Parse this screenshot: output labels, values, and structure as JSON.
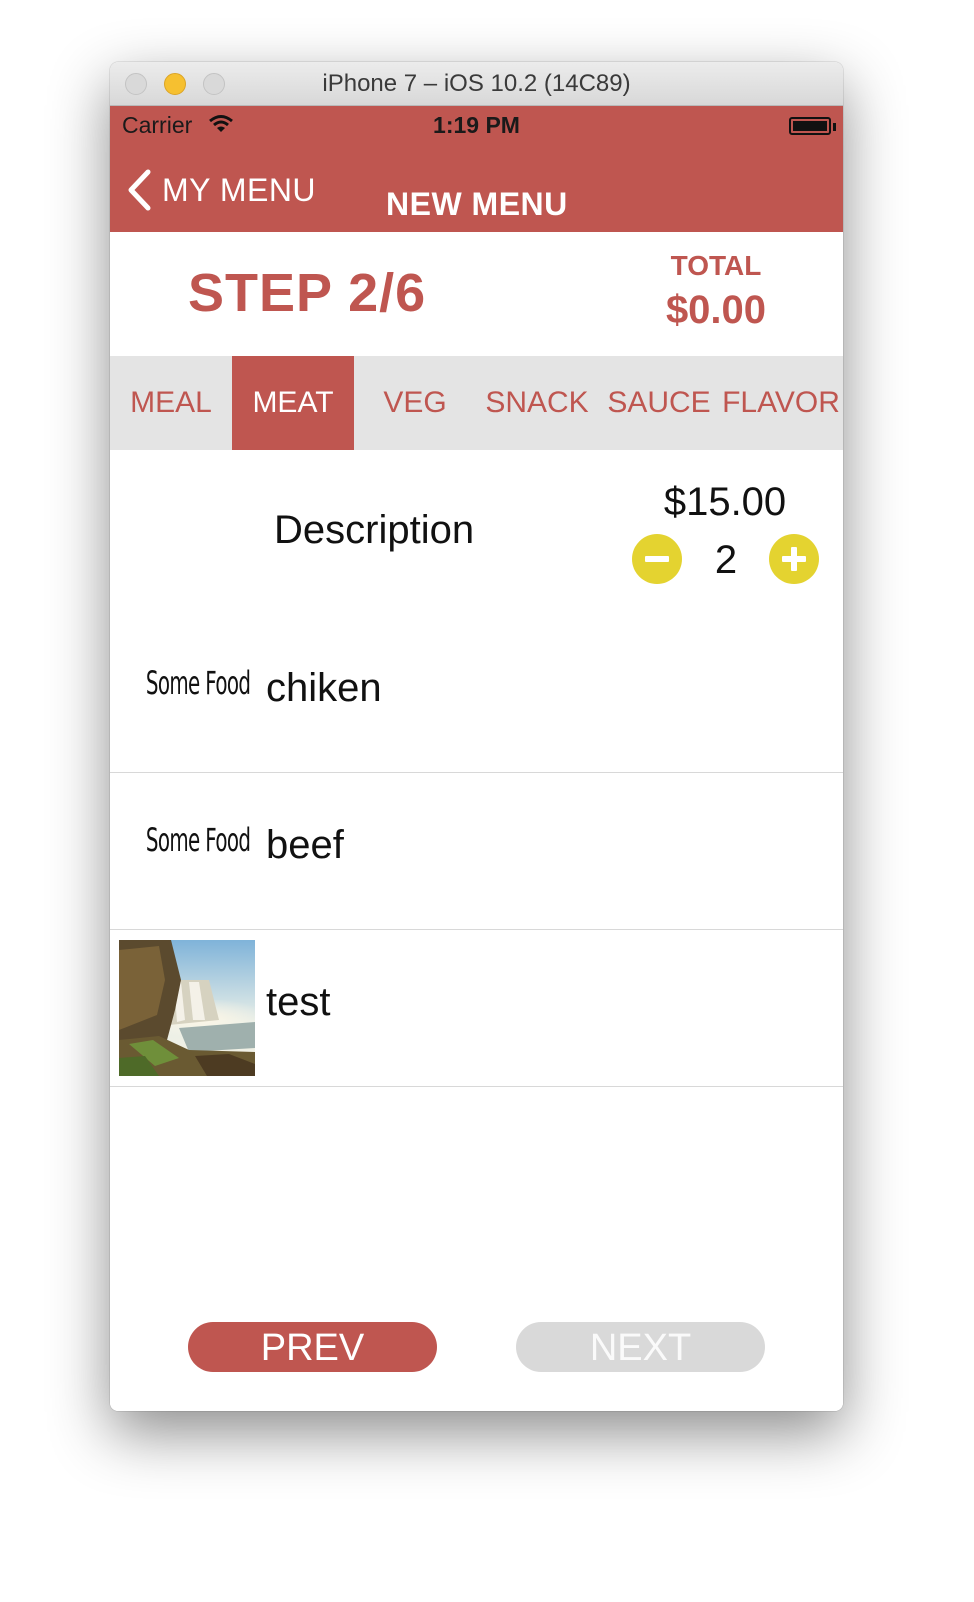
{
  "window": {
    "title": "iPhone 7 – iOS 10.2 (14C89)"
  },
  "status_bar": {
    "carrier": "Carrier",
    "time": "1:19 PM"
  },
  "nav": {
    "back_label": "MY MENU",
    "title": "NEW MENU"
  },
  "header": {
    "step": "STEP 2/6",
    "total_label": "TOTAL",
    "total_value": "$0.00"
  },
  "tabs": [
    {
      "label": "MEAL",
      "active": false
    },
    {
      "label": "MEAT",
      "active": true
    },
    {
      "label": "VEG",
      "active": false
    },
    {
      "label": "SNACK",
      "active": false
    },
    {
      "label": "SAUCE",
      "active": false
    },
    {
      "label": "FLAVOR",
      "active": false
    }
  ],
  "description": {
    "label": "Description",
    "price": "$15.00",
    "quantity": "2"
  },
  "items": [
    {
      "thumb_text": "Some Food",
      "label": "chiken"
    },
    {
      "thumb_text": "Some Food",
      "label": "beef"
    },
    {
      "thumb_image": "waterfall-landscape",
      "label": "test"
    }
  ],
  "footer": {
    "prev_label": "PREV",
    "next_label": "NEXT",
    "next_enabled": false
  },
  "colors": {
    "brand": "#bf5650",
    "accent": "#e4d330",
    "tab_bg": "#e4e4e4",
    "disabled": "#d9d9d9"
  }
}
